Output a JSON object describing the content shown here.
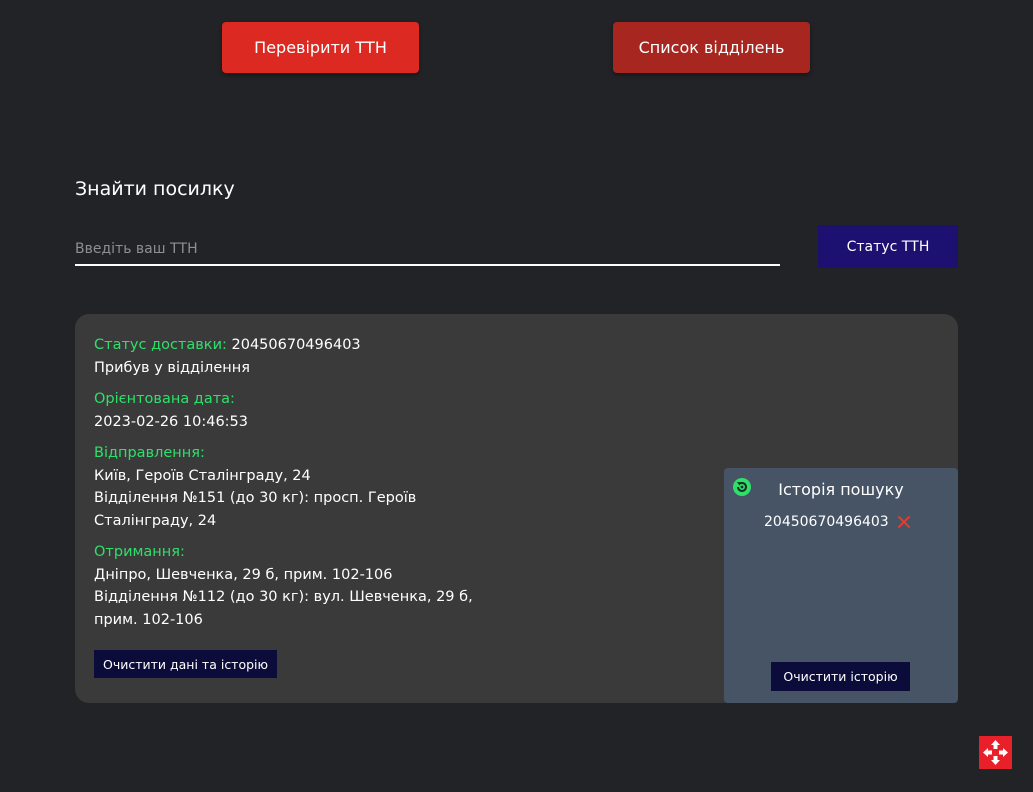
{
  "top_buttons": {
    "check_ttn": "Перевірити ТТН",
    "branch_list": "Список відділень"
  },
  "search": {
    "title": "Знайти посилку",
    "placeholder": "Введіть ваш ТТН",
    "value": "",
    "submit_label": "Статус ТТН"
  },
  "result": {
    "status_label": "Статус доставки:",
    "ttn": "20450670496403",
    "status_value": "Прибув у відділення",
    "date_label": "Орієнтована дата:",
    "date_value": "2023-02-26 10:46:53",
    "sender_label": "Відправлення:",
    "sender_address": "Київ, Героїв Сталінграду, 24",
    "sender_branch": "Відділення №151 (до 30 кг): просп. Героїв Сталінграду, 24",
    "recipient_label": "Отримання:",
    "recipient_address": "Дніпро, Шевченка, 29 б, прим. 102-106",
    "recipient_branch": "Відділення №112 (до 30 кг): вул. Шевченка, 29 б, прим. 102-106",
    "clear_all_label": "Очистити дані та історію"
  },
  "history": {
    "icon": "refresh-icon",
    "title": "Історія пошуку",
    "items": [
      "20450670496403"
    ],
    "delete_icon": "close-icon",
    "clear_label": "Очистити історію"
  },
  "colors": {
    "background": "#222327",
    "accent_red": "#dc2a22",
    "label_green": "#2ee06a",
    "status_button": "#1c1170",
    "history_panel": "#465466"
  },
  "logo": "nova-poshta-logo"
}
